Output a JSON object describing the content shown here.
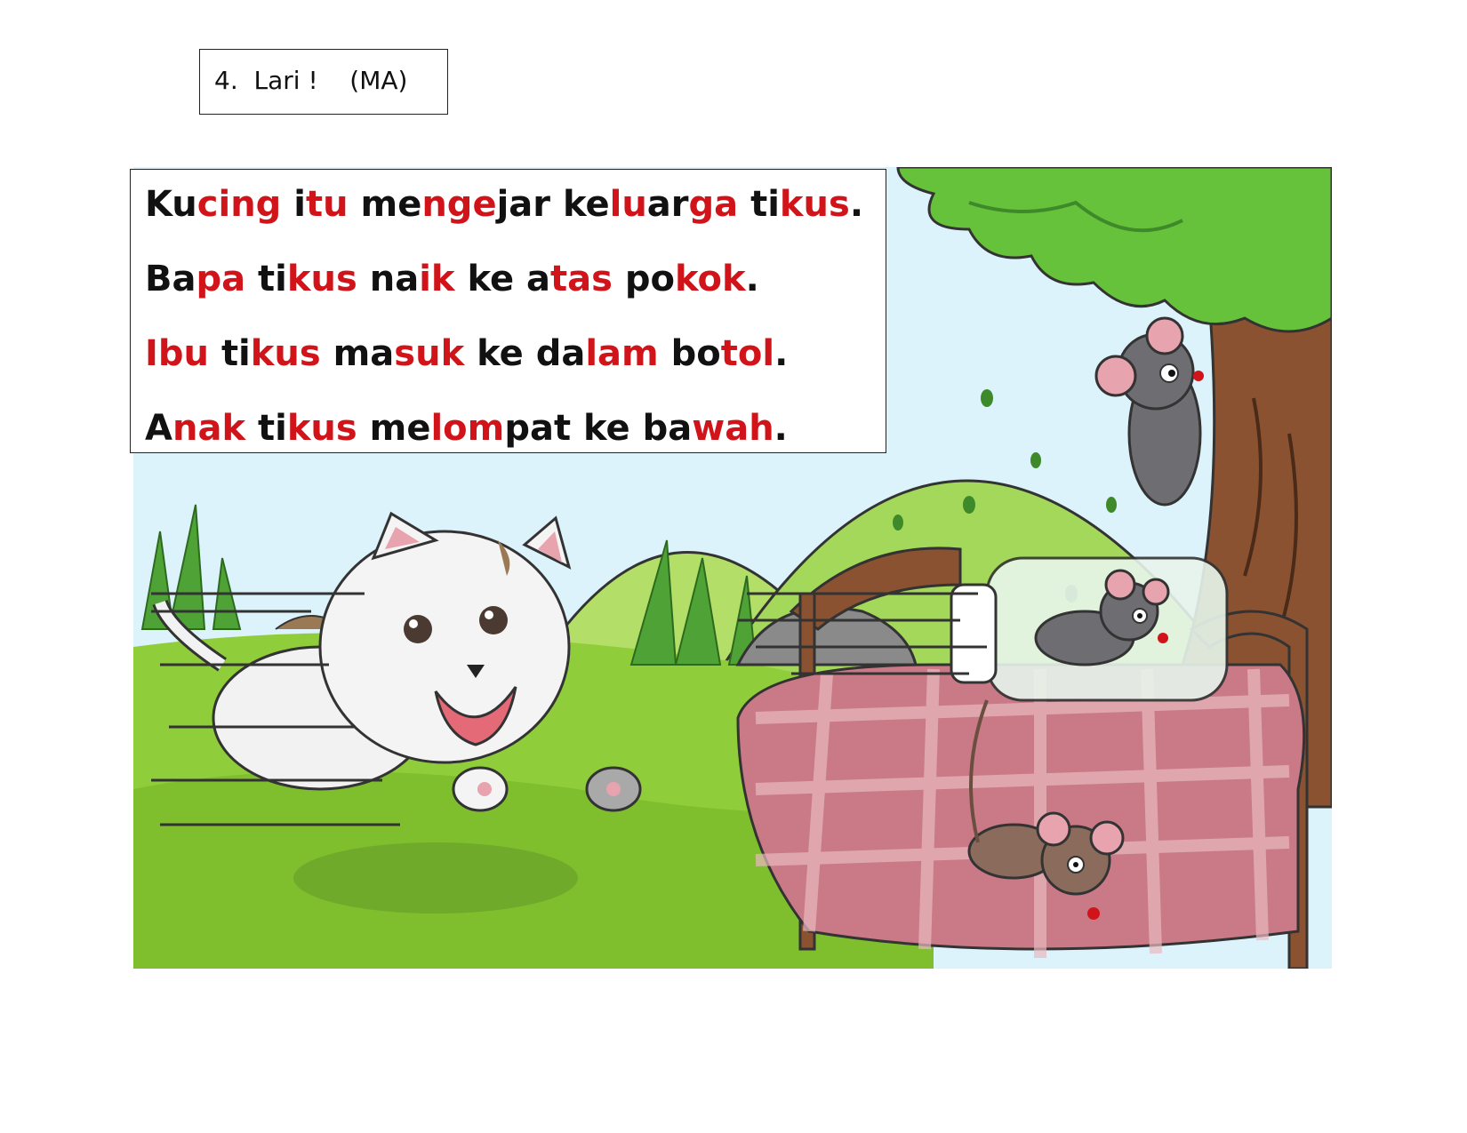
{
  "page": {
    "title": "4.  Lari !    (MA)"
  },
  "colors": {
    "text": "#111111",
    "syllable_highlight": "#d0141a",
    "sky": "#dcf3fb",
    "grass": "#8fce3a",
    "hill": "#a4d85a",
    "tree_leaves": "#66c23a",
    "trunk": "#8a5230",
    "tablecloth": "#c97a86",
    "mouse": "#6e6e72"
  },
  "sentences": [
    {
      "segments": [
        {
          "text": "Ku",
          "color": "black"
        },
        {
          "text": "cing",
          "color": "red"
        },
        {
          "text": " ",
          "color": "black"
        },
        {
          "text": "i",
          "color": "black"
        },
        {
          "text": "tu",
          "color": "red"
        },
        {
          "text": " ",
          "color": "black"
        },
        {
          "text": "me",
          "color": "black"
        },
        {
          "text": "nge",
          "color": "red"
        },
        {
          "text": "jar",
          "color": "black"
        },
        {
          "text": " ",
          "color": "black"
        },
        {
          "text": "ke",
          "color": "black"
        },
        {
          "text": "lu",
          "color": "red"
        },
        {
          "text": "ar",
          "color": "black"
        },
        {
          "text": "ga",
          "color": "red"
        },
        {
          "text": " ",
          "color": "black"
        },
        {
          "text": "ti",
          "color": "black"
        },
        {
          "text": "kus",
          "color": "red"
        },
        {
          "text": ".",
          "color": "black"
        }
      ]
    },
    {
      "segments": [
        {
          "text": "Ba",
          "color": "black"
        },
        {
          "text": "pa",
          "color": "red"
        },
        {
          "text": " ",
          "color": "black"
        },
        {
          "text": "ti",
          "color": "black"
        },
        {
          "text": "kus",
          "color": "red"
        },
        {
          "text": " ",
          "color": "black"
        },
        {
          "text": "na",
          "color": "black"
        },
        {
          "text": "ik",
          "color": "red"
        },
        {
          "text": " ",
          "color": "black"
        },
        {
          "text": "ke",
          "color": "black"
        },
        {
          "text": " ",
          "color": "black"
        },
        {
          "text": "a",
          "color": "black"
        },
        {
          "text": "tas",
          "color": "red"
        },
        {
          "text": " ",
          "color": "black"
        },
        {
          "text": "po",
          "color": "black"
        },
        {
          "text": "kok",
          "color": "red"
        },
        {
          "text": ".",
          "color": "black"
        }
      ]
    },
    {
      "segments": [
        {
          "text": "I",
          "color": "red"
        },
        {
          "text": "bu",
          "color": "red"
        },
        {
          "text": " ",
          "color": "black"
        },
        {
          "text": "ti",
          "color": "black"
        },
        {
          "text": "kus",
          "color": "red"
        },
        {
          "text": " ",
          "color": "black"
        },
        {
          "text": "ma",
          "color": "black"
        },
        {
          "text": "suk",
          "color": "red"
        },
        {
          "text": " ",
          "color": "black"
        },
        {
          "text": "ke",
          "color": "black"
        },
        {
          "text": " ",
          "color": "black"
        },
        {
          "text": "da",
          "color": "black"
        },
        {
          "text": "lam",
          "color": "red"
        },
        {
          "text": " ",
          "color": "black"
        },
        {
          "text": "bo",
          "color": "black"
        },
        {
          "text": "tol",
          "color": "red"
        },
        {
          "text": ".",
          "color": "black"
        }
      ]
    },
    {
      "segments": [
        {
          "text": "A",
          "color": "black"
        },
        {
          "text": "nak",
          "color": "red"
        },
        {
          "text": " ",
          "color": "black"
        },
        {
          "text": "ti",
          "color": "black"
        },
        {
          "text": "kus",
          "color": "red"
        },
        {
          "text": " ",
          "color": "black"
        },
        {
          "text": "me",
          "color": "black"
        },
        {
          "text": "lom",
          "color": "red"
        },
        {
          "text": "pat",
          "color": "black"
        },
        {
          "text": " ",
          "color": "black"
        },
        {
          "text": "ke",
          "color": "black"
        },
        {
          "text": " ",
          "color": "black"
        },
        {
          "text": "ba",
          "color": "black"
        },
        {
          "text": "wah",
          "color": "red"
        },
        {
          "text": ".",
          "color": "black"
        }
      ]
    }
  ]
}
